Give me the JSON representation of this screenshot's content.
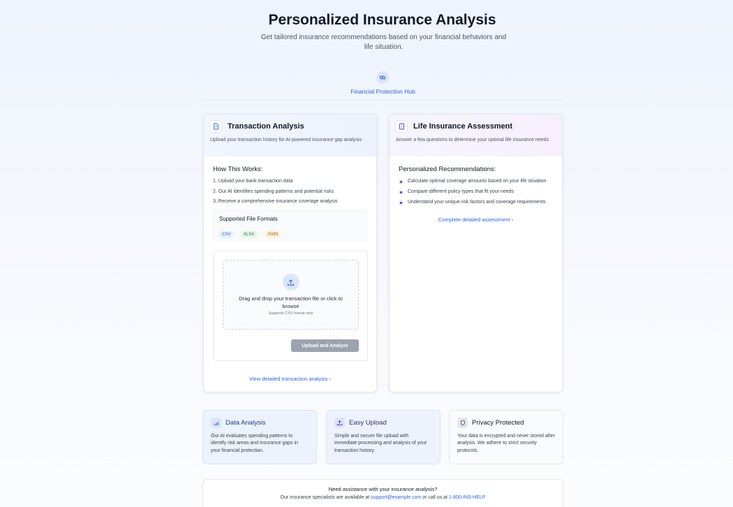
{
  "header": {
    "title": "Personalized Insurance Analysis",
    "subtitle": "Get tailored insurance recommendations based on your financial behaviors and life situation."
  },
  "hub": {
    "tab_label": "Financial Protection Hub",
    "icon": "link-icon"
  },
  "transaction_card": {
    "title": "Transaction Analysis",
    "description": "Upload your transaction history for AI-powered insurance gap analysis",
    "how_title": "How This Works:",
    "steps": [
      "1. Upload your bank transaction data",
      "2. Our AI identifies spending patterns and potential risks",
      "3. Receive a comprehensive insurance coverage analysis"
    ],
    "formats_title": "Supported File Formats",
    "formats": [
      "CSV",
      "XLSX",
      "JSON"
    ],
    "drop_text": "Drag and drop your transaction file or click to browse",
    "drop_sub": "Supports CSV format only",
    "upload_button": "Upload and Analyze",
    "link": "View detailed transaction analysis"
  },
  "life_card": {
    "title": "Life Insurance Assessment",
    "description": "Answer a few questions to determine your optimal life insurance needs",
    "rec_title": "Personalized Recommendations:",
    "bullets": [
      "Calculate optimal coverage amounts based on your life situation",
      "Compare different policy types that fit your needs",
      "Understand your unique risk factors and coverage requirements"
    ],
    "link": "Complete detailed assessment"
  },
  "features": [
    {
      "title": "Data Analysis",
      "text": "Our AI evaluates spending patterns to identify risk areas and insurance gaps in your financial protection.",
      "icon": "bar-chart-icon"
    },
    {
      "title": "Easy Upload",
      "text": "Simple and secure file upload with immediate processing and analysis of your transaction history.",
      "icon": "upload-icon"
    },
    {
      "title": "Privacy Protected",
      "text": "Your data is encrypted and never stored after analysis. We adhere to strict security protocols.",
      "icon": "shield-icon"
    }
  ],
  "support": {
    "title": "Need assistance with your insurance analysis?",
    "text_before": "Our insurance specialists are available at",
    "email": "support@example.com",
    "text_middle": "or call us at",
    "phone": "1-800-INS-HELP"
  },
  "colors": {
    "accent": "#2563eb",
    "button_disabled": "#9ca3af"
  }
}
